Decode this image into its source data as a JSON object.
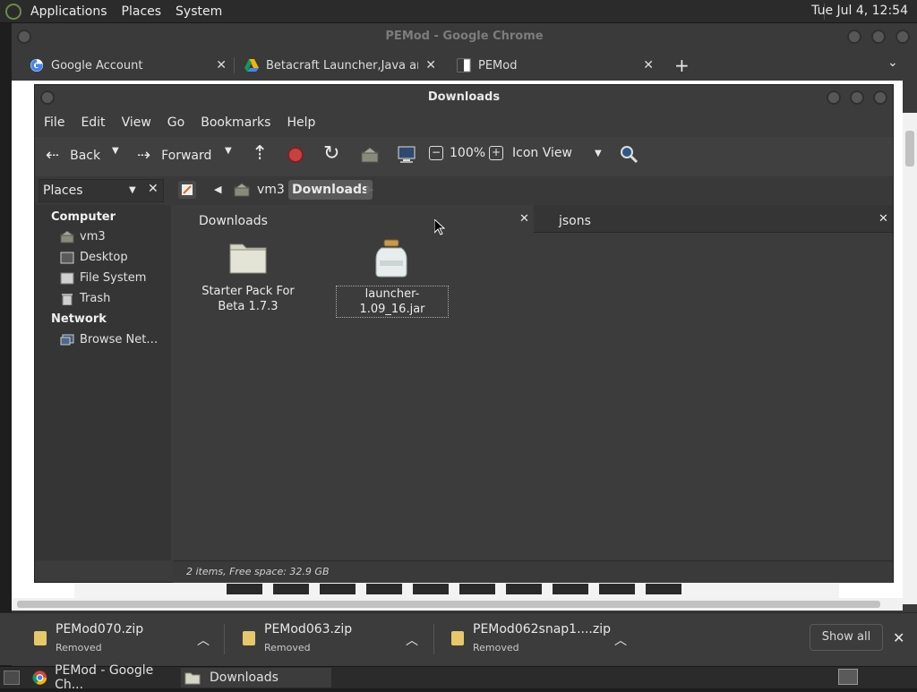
{
  "top_panel": {
    "menus": [
      "Applications",
      "Places",
      "System"
    ],
    "clock": "Tue Jul  4, 12:54"
  },
  "chrome": {
    "title": "PEMod - Google Chrome",
    "tabs": [
      {
        "label": "Google Account"
      },
      {
        "label": "Betacraft Launcher,Java and w"
      },
      {
        "label": "PEMod"
      }
    ],
    "new_tab": "+",
    "tab_menu": "⌄"
  },
  "file_manager": {
    "title": "Downloads",
    "menus": [
      "File",
      "Edit",
      "View",
      "Go",
      "Bookmarks",
      "Help"
    ],
    "toolbar": {
      "back": "Back",
      "forward": "Forward",
      "zoom": "100%",
      "view_mode": "Icon View"
    },
    "sidebar_selector": "Places",
    "path": [
      "vm3",
      "Downloads"
    ],
    "places": {
      "computer_header": "Computer",
      "computer_items": [
        "vm3",
        "Desktop",
        "File System",
        "Trash"
      ],
      "network_header": "Network",
      "network_items": [
        "Browse Net…"
      ]
    },
    "tabs": [
      {
        "label": "Downloads"
      },
      {
        "label": "jsons"
      }
    ],
    "files": [
      {
        "name": "Starter Pack For Beta 1.7.3",
        "kind": "folder"
      },
      {
        "name": "launcher-1.09_16.jar",
        "kind": "jar"
      }
    ],
    "status": "2 items, Free space: 32.9 GB"
  },
  "downloads_bar": {
    "items": [
      {
        "name": "PEMod070.zip",
        "status": "Removed"
      },
      {
        "name": "PEMod063.zip",
        "status": "Removed"
      },
      {
        "name": "PEMod062snap1....zip",
        "status": "Removed"
      }
    ],
    "show_all": "Show all"
  },
  "taskbar": {
    "items": [
      {
        "label": "PEMod - Google Ch..."
      },
      {
        "label": "Downloads"
      }
    ]
  }
}
